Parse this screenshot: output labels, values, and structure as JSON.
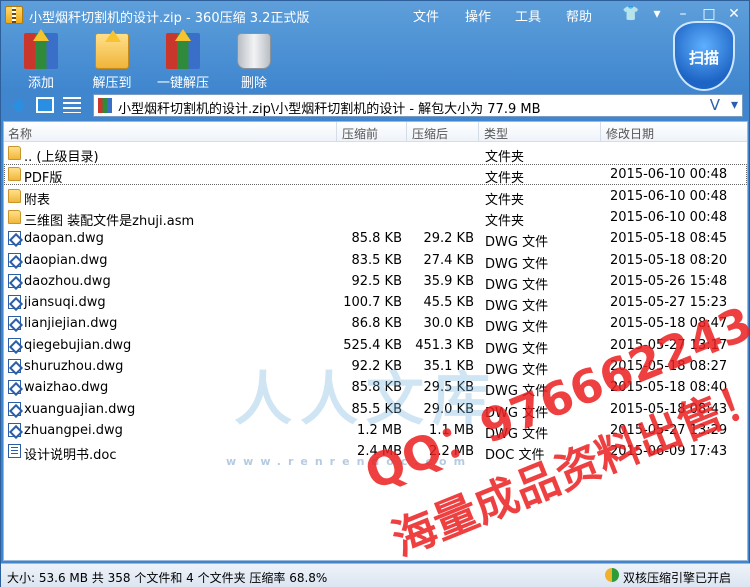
{
  "window": {
    "title": "小型烟秆切割机的设计.zip - 360压缩 3.2正式版",
    "menu": [
      "文件",
      "操作",
      "工具",
      "帮助"
    ]
  },
  "toolbar": {
    "add": "添加",
    "extract_to": "解压到",
    "one_click_extract": "一键解压",
    "delete": "删除",
    "scan": "扫描"
  },
  "address": {
    "path": "小型烟秆切割机的设计.zip\\小型烟秆切割机的设计 - 解包大小为 77.9 MB"
  },
  "columns": {
    "name": "名称",
    "compressed": "压缩前",
    "packed": "压缩后",
    "type": "类型",
    "modified": "修改日期"
  },
  "files": [
    {
      "name": ".. (上级目录)",
      "compressed": "",
      "packed": "",
      "type": "文件夹",
      "modified": "",
      "icon": "folder-icon"
    },
    {
      "name": "PDF版",
      "compressed": "",
      "packed": "",
      "type": "文件夹",
      "modified": "2015-06-10 00:48",
      "icon": "folder-icon"
    },
    {
      "name": "附表",
      "compressed": "",
      "packed": "",
      "type": "文件夹",
      "modified": "2015-06-10 00:48",
      "icon": "folder-icon"
    },
    {
      "name": "三维图 装配文件是zhuji.asm",
      "compressed": "",
      "packed": "",
      "type": "文件夹",
      "modified": "2015-06-10 00:48",
      "icon": "folder-icon"
    },
    {
      "name": "daopan.dwg",
      "compressed": "85.8 KB",
      "packed": "29.2 KB",
      "type": "DWG 文件",
      "modified": "2015-05-18 08:45",
      "icon": "dwg-file-icon"
    },
    {
      "name": "daopian.dwg",
      "compressed": "83.5 KB",
      "packed": "27.4 KB",
      "type": "DWG 文件",
      "modified": "2015-05-18 08:20",
      "icon": "dwg-file-icon"
    },
    {
      "name": "daozhou.dwg",
      "compressed": "92.5 KB",
      "packed": "35.9 KB",
      "type": "DWG 文件",
      "modified": "2015-05-26 15:48",
      "icon": "dwg-file-icon"
    },
    {
      "name": "jiansuqi.dwg",
      "compressed": "100.7 KB",
      "packed": "45.5 KB",
      "type": "DWG 文件",
      "modified": "2015-05-27 15:23",
      "icon": "dwg-file-icon"
    },
    {
      "name": "lianjiejian.dwg",
      "compressed": "86.8 KB",
      "packed": "30.0 KB",
      "type": "DWG 文件",
      "modified": "2015-05-18 08:47",
      "icon": "dwg-file-icon"
    },
    {
      "name": "qiegebujian.dwg",
      "compressed": "525.4 KB",
      "packed": "451.3 KB",
      "type": "DWG 文件",
      "modified": "2015-05-27 13:17",
      "icon": "dwg-file-icon"
    },
    {
      "name": "shuruzhou.dwg",
      "compressed": "92.2 KB",
      "packed": "35.1 KB",
      "type": "DWG 文件",
      "modified": "2015-05-18 08:27",
      "icon": "dwg-file-icon"
    },
    {
      "name": "waizhao.dwg",
      "compressed": "85.8 KB",
      "packed": "29.5 KB",
      "type": "DWG 文件",
      "modified": "2015-05-18 08:40",
      "icon": "dwg-file-icon"
    },
    {
      "name": "xuanguajian.dwg",
      "compressed": "85.5 KB",
      "packed": "29.0 KB",
      "type": "DWG 文件",
      "modified": "2015-05-18 08:43",
      "icon": "dwg-file-icon"
    },
    {
      "name": "zhuangpei.dwg",
      "compressed": "1.2 MB",
      "packed": "1.1 MB",
      "type": "DWG 文件",
      "modified": "2015-05-27 13:29",
      "icon": "dwg-file-icon"
    },
    {
      "name": "设计说明书.doc",
      "compressed": "2.4 MB",
      "packed": "2.2 MB",
      "type": "DOC 文件",
      "modified": "2015-06-09 17:43",
      "icon": "doc-file-icon"
    }
  ],
  "watermark": {
    "logo": "人人文库",
    "url": "www.renrendoc.com",
    "qq": "QQ：976662243",
    "slogan": "海量成品资料出售！"
  },
  "status": {
    "summary": "大小: 53.6 MB 共 358 个文件和 4 个文件夹 压缩率 68.8%",
    "engine": "双核压缩引擎已开启"
  }
}
